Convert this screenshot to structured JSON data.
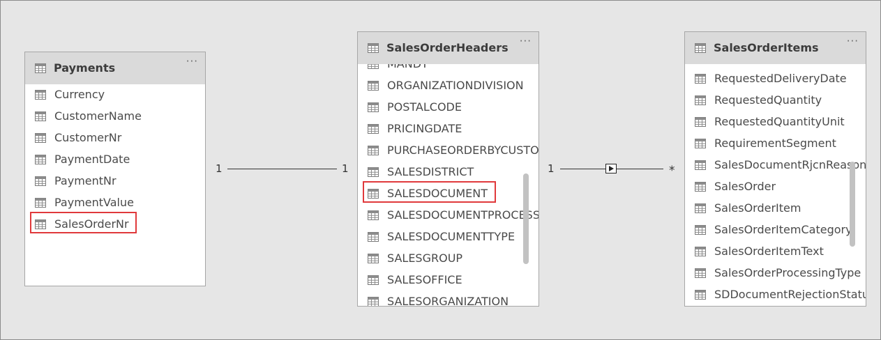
{
  "tables": {
    "payments": {
      "title": "Payments",
      "menu": "···",
      "fields": [
        "Currency",
        "CustomerName",
        "CustomerNr",
        "PaymentDate",
        "PaymentNr",
        "PaymentValue",
        "SalesOrderNr"
      ],
      "highlighted_field": "SalesOrderNr"
    },
    "sales_order_headers": {
      "title": "SalesOrderHeaders",
      "menu": "···",
      "fields": [
        "MANDT",
        "ORGANIZATIONDIVISION",
        "POSTALCODE",
        "PRICINGDATE",
        "PURCHASEORDERBYCUSTOMER",
        "SALESDISTRICT",
        "SALESDOCUMENT",
        "SALESDOCUMENTPROCESSINGTYPE",
        "SALESDOCUMENTTYPE",
        "SALESGROUP",
        "SALESOFFICE",
        "SALESORGANIZATION"
      ],
      "highlighted_field": "SALESDOCUMENT"
    },
    "sales_order_items": {
      "title": "SalesOrderItems",
      "menu": "···",
      "fields": [
        "RequestedDeliveryDate",
        "RequestedQuantity",
        "RequestedQuantityUnit",
        "RequirementSegment",
        "SalesDocumentRjcnReason",
        "SalesOrder",
        "SalesOrderItem",
        "SalesOrderItemCategory",
        "SalesOrderItemText",
        "SalesOrderProcessingType",
        "SDDocumentRejectionStatus"
      ]
    }
  },
  "relationships": [
    {
      "from": "Payments",
      "to": "SalesOrderHeaders",
      "from_card": "1",
      "to_card": "1"
    },
    {
      "from": "SalesOrderHeaders",
      "to": "SalesOrderItems",
      "from_card": "1",
      "to_card": "*",
      "direction_icon": "play-arrow-icon"
    }
  ],
  "colors": {
    "canvas": "#e6e6e6",
    "header": "#dadada",
    "highlight": "#e0393b",
    "text": "#4a4a4a"
  }
}
